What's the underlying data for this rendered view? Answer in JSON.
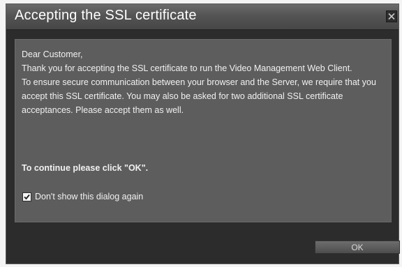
{
  "dialog": {
    "title": "Accepting the SSL certificate",
    "close_icon": "close-x-icon",
    "message": {
      "greeting": "Dear Customer,",
      "line1": "Thank you for accepting the SSL certificate to run the Video Management Web Client.",
      "line2": "To ensure secure communication between your browser and the Server, we require that you accept this SSL certificate. You may also be asked for two additional SSL certificate acceptances. Please accept them as well.",
      "continue_text": "To continue please click \"OK\"."
    },
    "checkbox": {
      "label": "Don't show this dialog again",
      "checked": true
    },
    "ok_label": "OK",
    "colors": {
      "background": "#2c2c2c",
      "titlebar": "#545454",
      "panel": "#5d5d5d",
      "text": "#f1f1f1"
    }
  }
}
